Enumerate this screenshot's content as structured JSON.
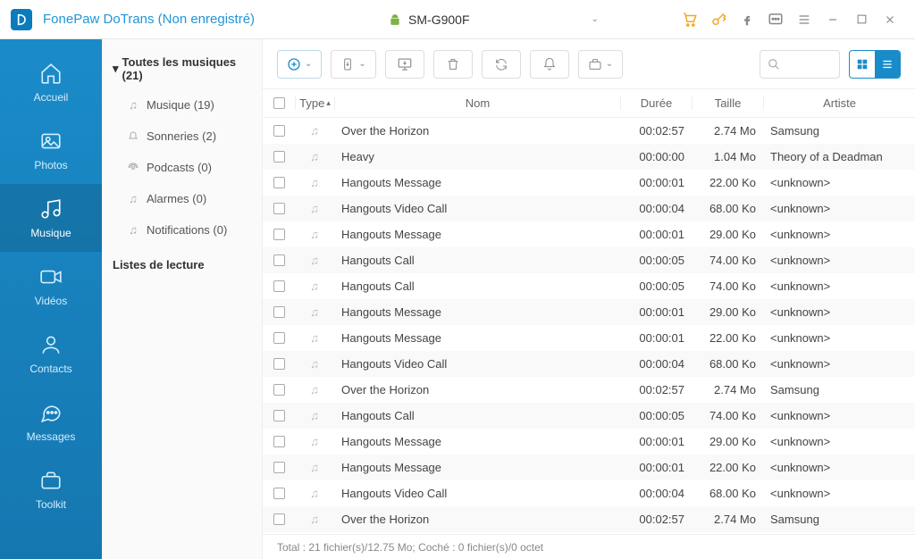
{
  "app": {
    "title": "FonePaw DoTrans (Non enregistré)",
    "device": "SM-G900F"
  },
  "sidebar": {
    "items": [
      {
        "label": "Accueil"
      },
      {
        "label": "Photos"
      },
      {
        "label": "Musique"
      },
      {
        "label": "Vidéos"
      },
      {
        "label": "Contacts"
      },
      {
        "label": "Messages"
      },
      {
        "label": "Toolkit"
      }
    ]
  },
  "subpanel": {
    "group_title": "Toutes les musiques (21)",
    "items": [
      {
        "label": "Musique (19)"
      },
      {
        "label": "Sonneries (2)"
      },
      {
        "label": "Podcasts (0)"
      },
      {
        "label": "Alarmes (0)"
      },
      {
        "label": "Notifications (0)"
      }
    ],
    "playlists": "Listes de lecture"
  },
  "table": {
    "headers": {
      "type": "Type",
      "name": "Nom",
      "duration": "Durée",
      "size": "Taille",
      "artist": "Artiste"
    },
    "rows": [
      {
        "name": "Over the Horizon",
        "duration": "00:02:57",
        "size": "2.74 Mo",
        "artist": "Samsung"
      },
      {
        "name": "Heavy",
        "duration": "00:00:00",
        "size": "1.04 Mo",
        "artist": "Theory of a Deadman"
      },
      {
        "name": "Hangouts Message",
        "duration": "00:00:01",
        "size": "22.00 Ko",
        "artist": "<unknown>"
      },
      {
        "name": "Hangouts Video Call",
        "duration": "00:00:04",
        "size": "68.00 Ko",
        "artist": "<unknown>"
      },
      {
        "name": "Hangouts Message",
        "duration": "00:00:01",
        "size": "29.00 Ko",
        "artist": "<unknown>"
      },
      {
        "name": "Hangouts Call",
        "duration": "00:00:05",
        "size": "74.00 Ko",
        "artist": "<unknown>"
      },
      {
        "name": "Hangouts Call",
        "duration": "00:00:05",
        "size": "74.00 Ko",
        "artist": "<unknown>"
      },
      {
        "name": "Hangouts Message",
        "duration": "00:00:01",
        "size": "29.00 Ko",
        "artist": "<unknown>"
      },
      {
        "name": "Hangouts Message",
        "duration": "00:00:01",
        "size": "22.00 Ko",
        "artist": "<unknown>"
      },
      {
        "name": "Hangouts Video Call",
        "duration": "00:00:04",
        "size": "68.00 Ko",
        "artist": "<unknown>"
      },
      {
        "name": "Over the Horizon",
        "duration": "00:02:57",
        "size": "2.74 Mo",
        "artist": "Samsung"
      },
      {
        "name": "Hangouts Call",
        "duration": "00:00:05",
        "size": "74.00 Ko",
        "artist": "<unknown>"
      },
      {
        "name": "Hangouts Message",
        "duration": "00:00:01",
        "size": "29.00 Ko",
        "artist": "<unknown>"
      },
      {
        "name": "Hangouts Message",
        "duration": "00:00:01",
        "size": "22.00 Ko",
        "artist": "<unknown>"
      },
      {
        "name": "Hangouts Video Call",
        "duration": "00:00:04",
        "size": "68.00 Ko",
        "artist": "<unknown>"
      },
      {
        "name": "Over the Horizon",
        "duration": "00:02:57",
        "size": "2.74 Mo",
        "artist": "Samsung"
      }
    ]
  },
  "status": "Total : 21 fichier(s)/12.75 Mo; Coché : 0 fichier(s)/0 octet"
}
